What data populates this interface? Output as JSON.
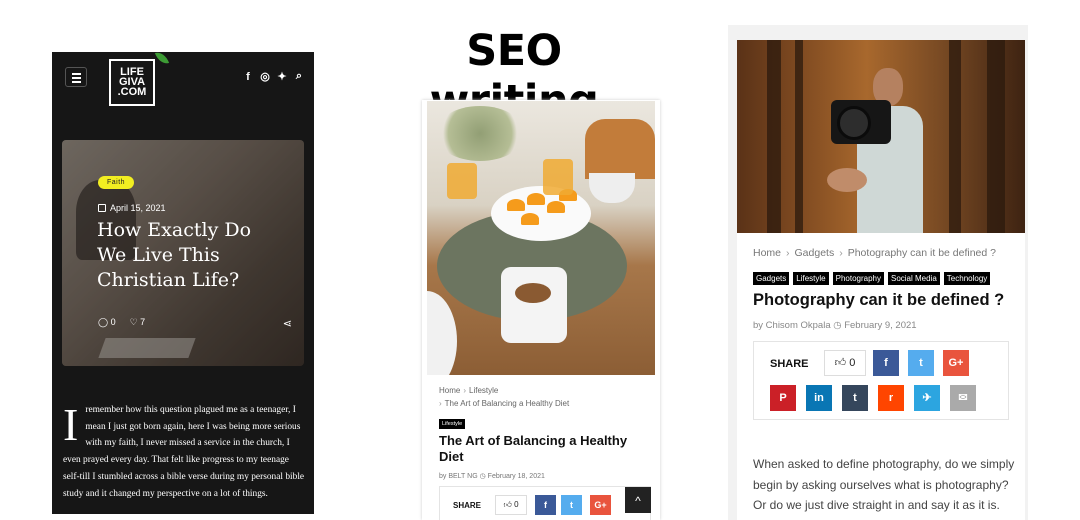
{
  "heading": "SEO writing",
  "phone1": {
    "logo_line1": "LIFE",
    "logo_line2": "GIVA",
    "logo_line3": ".COM",
    "social_icons": [
      "facebook-icon",
      "instagram-icon",
      "twitter-icon",
      "search-icon"
    ],
    "hero": {
      "badge": "Faith",
      "date": "April 15, 2021",
      "title": "How Exactly Do We Live This Christian Life?",
      "comments": "0",
      "likes": "7"
    },
    "dropcap": "I",
    "body": "remember how this question plagued me as a teenager, I mean I just got born again, here I was being more serious with my faith, I never missed a service in the church, I even prayed every day. That felt like progress to my teenage self-till I stumbled across a bible verse during my personal bible study and it changed my perspective on a lot of things."
  },
  "phone2": {
    "breadcrumb": [
      "Home",
      "Lifestyle",
      "The Art of Balancing a Healthy Diet"
    ],
    "tag": "Lifestyle",
    "title": "The Art of Balancing a Healthy Diet",
    "author": "by BELT NG",
    "date": "February 18, 2021",
    "share_label": "SHARE",
    "like_count": "0",
    "share_buttons": [
      {
        "label": "f",
        "color": "#3b5998"
      },
      {
        "label": "t",
        "color": "#55acee"
      },
      {
        "label": "G+",
        "color": "#e9543d"
      }
    ],
    "scroll_top": "^"
  },
  "phone3": {
    "breadcrumb": [
      "Home",
      "Gadgets",
      "Photography can it be defined ?"
    ],
    "tags": [
      "Gadgets",
      "Lifestyle",
      "Photography",
      "Social Media",
      "Technology"
    ],
    "title": "Photography can it be defined ?",
    "author": "by Chisom Okpala",
    "date": "February 9, 2021",
    "share_label": "SHARE",
    "like_count": "0",
    "share_buttons_row1": [
      {
        "label": "f",
        "color": "#3b5998"
      },
      {
        "label": "t",
        "color": "#55acee"
      },
      {
        "label": "G+",
        "color": "#e9543d"
      }
    ],
    "share_buttons_row2": [
      {
        "label": "P",
        "color": "#cb2027"
      },
      {
        "label": "in",
        "color": "#0976b4"
      },
      {
        "label": "t",
        "color": "#35465c"
      },
      {
        "label": "r",
        "color": "#ff4500"
      },
      {
        "label": "✈",
        "color": "#2ca5e0"
      },
      {
        "label": "✉",
        "color": "#aaaaaa"
      }
    ],
    "body": "When asked to define photography, do we simply begin by asking ourselves what is photography? Or do we just dive straight in and say it as it is."
  }
}
